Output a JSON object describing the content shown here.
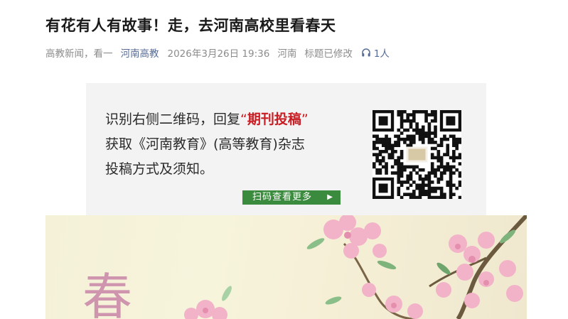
{
  "article": {
    "title": "有花有人有故事！走，去河南高校里看春天"
  },
  "meta": {
    "source_prefix": "高教新闻，看一",
    "account_name": "河南高教",
    "datetime": "2026年3月26日 19:36",
    "location": "河南",
    "edited_note": "标题已修改",
    "listen_icon": "headphones-icon",
    "listeners": "1人"
  },
  "promo": {
    "line1_prefix": "识别右侧二维码，回复",
    "line1_open_quote": "“",
    "line1_keyword": "期刊投稿",
    "line1_close_quote": "”",
    "line2": "获取《河南教育》(高等教育)杂志",
    "line3": "投稿方式及须知。",
    "button_label": "扫码查看更多",
    "button_arrow": "▶"
  },
  "banner": {
    "char": "春"
  },
  "colors": {
    "link": "#576b95",
    "keyword": "#c91d23",
    "button_bg": "#3b8b3e",
    "promo_bg": "#f3f3f3"
  }
}
